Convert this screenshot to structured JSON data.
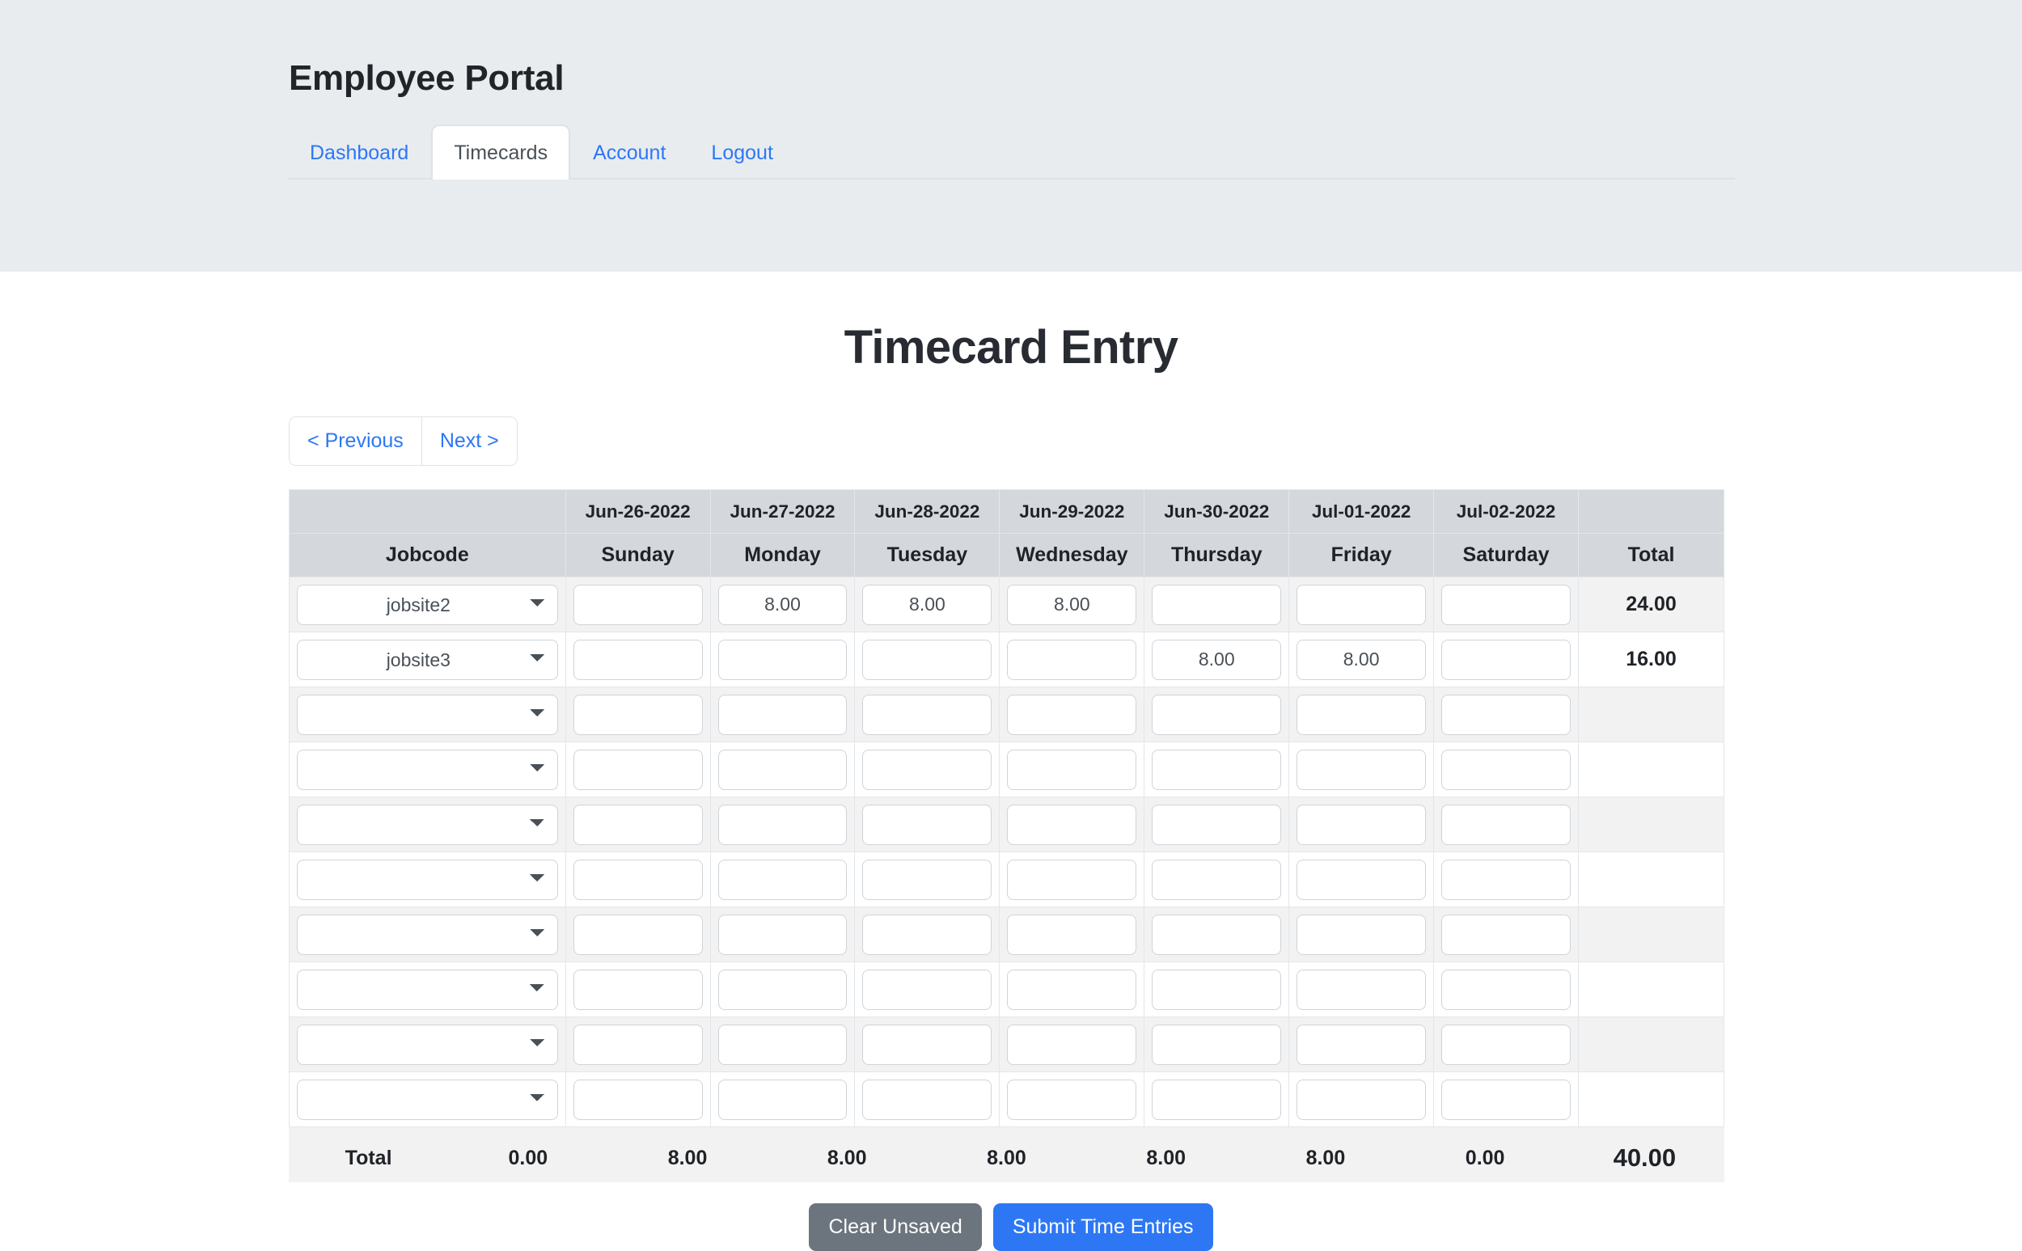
{
  "header": {
    "app_title": "Employee Portal",
    "nav": [
      {
        "label": "Dashboard",
        "active": false
      },
      {
        "label": "Timecards",
        "active": true
      },
      {
        "label": "Account",
        "active": false
      },
      {
        "label": "Logout",
        "active": false
      }
    ]
  },
  "main": {
    "page_title": "Timecard Entry",
    "pager": {
      "previous_label": "< Previous",
      "next_label": "Next >"
    },
    "table": {
      "dates": [
        "Jun-26-2022",
        "Jun-27-2022",
        "Jun-28-2022",
        "Jun-29-2022",
        "Jun-30-2022",
        "Jul-01-2022",
        "Jul-02-2022"
      ],
      "headers": {
        "jobcode": "Jobcode",
        "days": [
          "Sunday",
          "Monday",
          "Tuesday",
          "Wednesday",
          "Thursday",
          "Friday",
          "Saturday"
        ],
        "total": "Total"
      },
      "rows": [
        {
          "jobcode": "jobsite2",
          "hours": [
            "",
            "8.00",
            "8.00",
            "8.00",
            "",
            "",
            ""
          ],
          "total": "24.00"
        },
        {
          "jobcode": "jobsite3",
          "hours": [
            "",
            "",
            "",
            "",
            "8.00",
            "8.00",
            ""
          ],
          "total": "16.00"
        },
        {
          "jobcode": "",
          "hours": [
            "",
            "",
            "",
            "",
            "",
            "",
            ""
          ],
          "total": ""
        },
        {
          "jobcode": "",
          "hours": [
            "",
            "",
            "",
            "",
            "",
            "",
            ""
          ],
          "total": ""
        },
        {
          "jobcode": "",
          "hours": [
            "",
            "",
            "",
            "",
            "",
            "",
            ""
          ],
          "total": ""
        },
        {
          "jobcode": "",
          "hours": [
            "",
            "",
            "",
            "",
            "",
            "",
            ""
          ],
          "total": ""
        },
        {
          "jobcode": "",
          "hours": [
            "",
            "",
            "",
            "",
            "",
            "",
            ""
          ],
          "total": ""
        },
        {
          "jobcode": "",
          "hours": [
            "",
            "",
            "",
            "",
            "",
            "",
            ""
          ],
          "total": ""
        },
        {
          "jobcode": "",
          "hours": [
            "",
            "",
            "",
            "",
            "",
            "",
            ""
          ],
          "total": ""
        },
        {
          "jobcode": "",
          "hours": [
            "",
            "",
            "",
            "",
            "",
            "",
            ""
          ],
          "total": ""
        }
      ],
      "footer": {
        "label": "Total",
        "day_totals": [
          "0.00",
          "8.00",
          "8.00",
          "8.00",
          "8.00",
          "8.00",
          "0.00"
        ],
        "grand_total": "40.00"
      },
      "jobcode_options": [
        "",
        "jobsite2",
        "jobsite3"
      ]
    },
    "actions": {
      "clear_label": "Clear Unsaved",
      "submit_label": "Submit Time Entries"
    }
  },
  "colors": {
    "link": "#2d77f5",
    "header_band": "#e9ecef",
    "table_header": "#d4d8dd",
    "row_stripe": "#f2f2f2",
    "clear_button": "#6c757d",
    "submit_button": "#2d77f5"
  }
}
